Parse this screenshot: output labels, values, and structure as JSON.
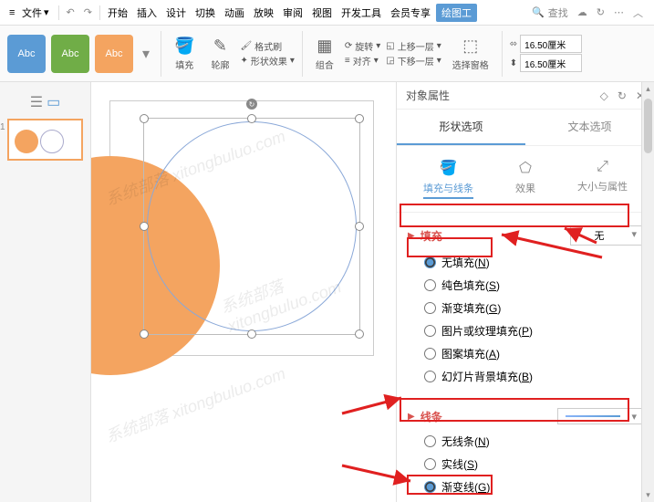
{
  "menubar": {
    "file": "文件",
    "tabs": [
      "开始",
      "插入",
      "设计",
      "切换",
      "动画",
      "放映",
      "审阅",
      "视图",
      "开发工具",
      "会员专享",
      "绘图工"
    ],
    "active_tab_index": 10,
    "search_placeholder": "查找"
  },
  "ribbon": {
    "preset_label": "Abc",
    "fill": "填充",
    "outline": "轮廓",
    "format_painter": "格式刷",
    "shape_effects": "形状效果",
    "group": "组合",
    "rotate": "旋转",
    "align": "对齐",
    "bring_forward": "上移一层",
    "send_backward": "下移一层",
    "selection_pane": "选择窗格",
    "width_value": "16.50厘米",
    "height_value": "16.50厘米"
  },
  "thumbs": {
    "slide_number": "1"
  },
  "panel": {
    "title": "对象属性",
    "tabs": {
      "shape": "形状选项",
      "text": "文本选项"
    },
    "subtabs": {
      "fill_line": "填充与线条",
      "effects": "效果",
      "size_props": "大小与属性"
    },
    "fill_section": {
      "name": "填充",
      "selected": "无",
      "options": {
        "none": {
          "label": "无填充",
          "key": "N"
        },
        "solid": {
          "label": "纯色填充",
          "key": "S"
        },
        "gradient": {
          "label": "渐变填充",
          "key": "G"
        },
        "picture": {
          "label": "图片或纹理填充",
          "key": "P"
        },
        "pattern": {
          "label": "图案填充",
          "key": "A"
        },
        "slide_bg": {
          "label": "幻灯片背景填充",
          "key": "B"
        }
      }
    },
    "line_section": {
      "name": "线条",
      "options": {
        "none": {
          "label": "无线条",
          "key": "N"
        },
        "solid": {
          "label": "实线",
          "key": "S"
        },
        "gradient": {
          "label": "渐变线",
          "key": "G"
        }
      }
    }
  },
  "colors": {
    "accent": "#5b9bd5",
    "red": "#e02020",
    "orange": "#f4a460"
  }
}
